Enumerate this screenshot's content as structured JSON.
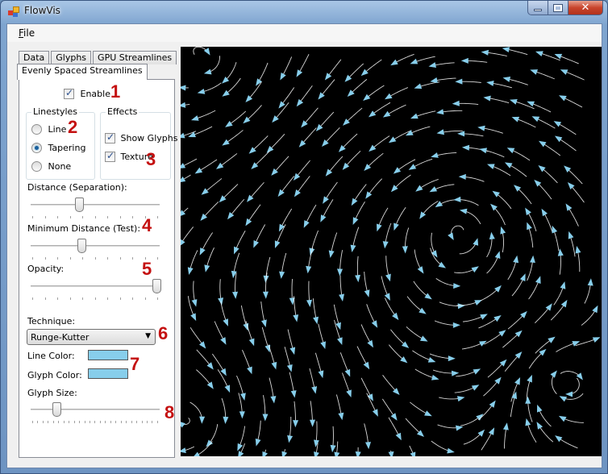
{
  "window": {
    "title": "FlowVis",
    "controls": {
      "minimize": "minimize",
      "maximize": "maximize",
      "close": "✕"
    }
  },
  "menu": {
    "file_accel": "F",
    "file_rest": "ile"
  },
  "tabs": {
    "row1": [
      "Data",
      "Glyphs",
      "GPU Streamlines"
    ],
    "active": "Evenly Spaced Streamlines"
  },
  "panel": {
    "enable": {
      "label": "Enable",
      "checked": true
    },
    "linestyles": {
      "title": "Linestyles",
      "options": [
        {
          "label": "Line",
          "selected": false
        },
        {
          "label": "Tapering",
          "selected": true
        },
        {
          "label": "None",
          "selected": false
        }
      ]
    },
    "effects": {
      "title": "Effects",
      "options": [
        {
          "label": "Show Glyphs",
          "checked": true
        },
        {
          "label": "Texture",
          "checked": true
        }
      ]
    },
    "sliders": [
      {
        "label": "Distance (Separation):",
        "value_fraction": 0.37,
        "ticks": 11
      },
      {
        "label": "Minimum Distance (Test):",
        "value_fraction": 0.39,
        "ticks": 11
      },
      {
        "label": "Opacity:",
        "value_fraction": 1.0,
        "ticks": 11
      },
      {
        "label": "Glyph Size:",
        "value_fraction": 0.19,
        "ticks": 25
      }
    ],
    "technique": {
      "label": "Technique:",
      "selected": "Runge-Kutter"
    },
    "line_color": {
      "label": "Line Color:",
      "color": "#87ceeb"
    },
    "glyph_color": {
      "label": "Glyph Color:",
      "color": "#87ceeb"
    }
  },
  "annotations": [
    "1",
    "2",
    "3",
    "4",
    "5",
    "6",
    "7",
    "8"
  ],
  "visualization": {
    "background": "#000000",
    "line_color": "#ffffff",
    "glyph_color": "#87ceeb"
  }
}
